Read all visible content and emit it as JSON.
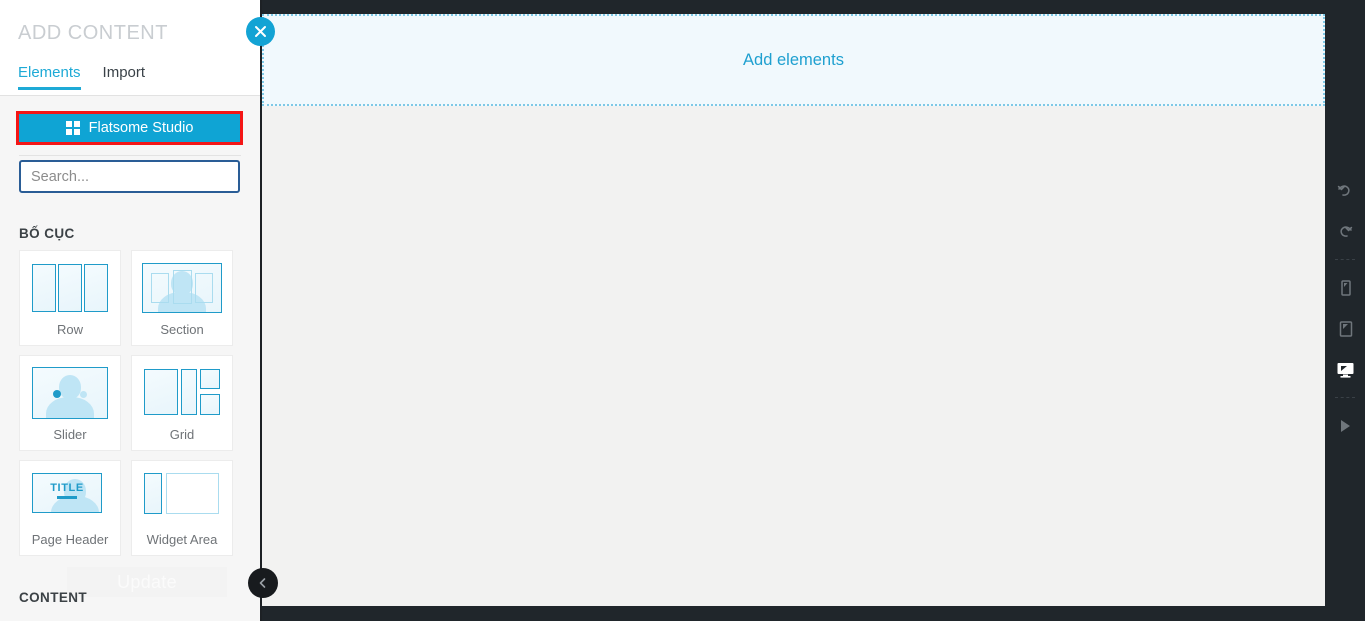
{
  "panel": {
    "title": "ADD CONTENT",
    "tabs": [
      {
        "label": "Elements",
        "active": true
      },
      {
        "label": "Import",
        "active": false
      }
    ],
    "studio_button": {
      "label": "Flatsome Studio",
      "icon": "grid-icon",
      "bg": "#0fa4d4",
      "highlight": "#f41616"
    },
    "search": {
      "value": "",
      "placeholder": "Search...",
      "border": "#2a5d96"
    },
    "sections": [
      {
        "id": "layout",
        "heading": "BỐ CỤC"
      },
      {
        "id": "content",
        "heading": "CONTENT"
      }
    ],
    "layout_cards": [
      {
        "label": "Row",
        "icon": "row-icon"
      },
      {
        "label": "Section",
        "icon": "section-icon"
      },
      {
        "label": "Slider",
        "icon": "slider-icon"
      },
      {
        "label": "Grid",
        "icon": "grid-layout-icon"
      },
      {
        "label": "Page Header",
        "icon": "page-header-icon"
      },
      {
        "label": "Widget Area",
        "icon": "widget-area-icon"
      }
    ],
    "page_header_thumb_text": "TITLE",
    "ghost_update_label": "Update"
  },
  "canvas": {
    "add_elements_label": "Add elements",
    "accent": "#1fa0d0",
    "zone_bg": "#f1f9fd",
    "zone_border": "#7ec9e6"
  },
  "buttons": {
    "close_label": "close-icon",
    "collapse_label": "chevron-left-icon"
  },
  "right_toolbar": {
    "items": [
      {
        "name": "undo",
        "icon": "undo-icon",
        "active": false
      },
      {
        "name": "redo",
        "icon": "redo-icon",
        "active": false
      },
      {
        "name": "mobile",
        "icon": "mobile-icon",
        "active": false
      },
      {
        "name": "tablet",
        "icon": "tablet-icon",
        "active": false
      },
      {
        "name": "desktop",
        "icon": "desktop-icon",
        "active": true
      },
      {
        "name": "preview",
        "icon": "play-icon",
        "active": false
      }
    ]
  }
}
